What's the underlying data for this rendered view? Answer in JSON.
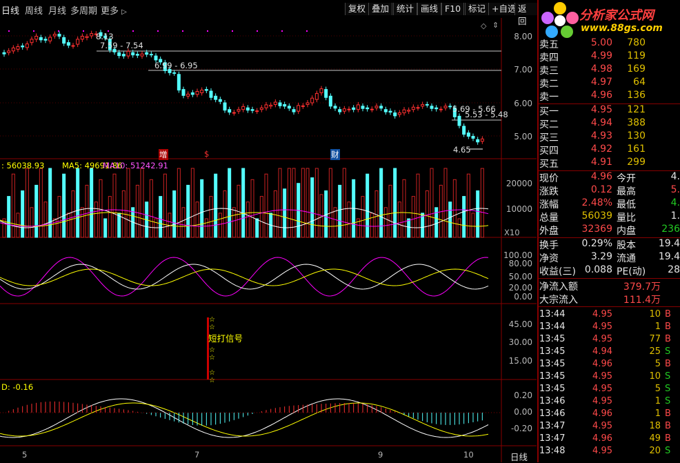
{
  "tabs": [
    {
      "label": "日线"
    },
    {
      "label": "周线"
    },
    {
      "label": "月线"
    },
    {
      "label": "多周期"
    },
    {
      "label": "更多"
    }
  ],
  "toolbar": [
    "复权",
    "叠加",
    "统计",
    "画线",
    "F10",
    "标记",
    "+自选",
    "返回"
  ],
  "logo": {
    "text": "分析家公式网",
    "url": "www.88gs.com"
  },
  "price_axis": [
    "8.00",
    "7.00",
    "6.00",
    "5.00"
  ],
  "annotations": {
    "high": "8.13",
    "r1": "7.59 - 7.54",
    "r2": "6.99 - 6.95",
    "r3": "5.69 - 5.66",
    "r4": "5.53 - 5.48",
    "low": "4.65",
    "badges": [
      "增",
      "$",
      "财"
    ]
  },
  "volume": {
    "vol_label": "56038.93",
    "ma5_label": "MA5: 49691.86",
    "ma10_label": "MA10: 51242.91",
    "axis": [
      "20000",
      "10000"
    ],
    "unit": "X10"
  },
  "kdj_axis": [
    "100.00",
    "80.00",
    "50.00",
    "20.00",
    "0.00"
  ],
  "signal": {
    "label": "短打信号",
    "axis": [
      "45.00",
      "30.00",
      "15.00"
    ]
  },
  "macd": {
    "label": "D: -0.16",
    "axis": [
      "0.20",
      "0.00",
      "-0.20"
    ]
  },
  "xaxis": {
    "labels": [
      "5",
      "7",
      "9",
      "10"
    ],
    "period": "日线"
  },
  "colors": {
    "up": "#ff3030",
    "down": "#54ffff",
    "ma5": "#ffffff",
    "ma10": "#ffff00",
    "ma20": "#ff00ff"
  },
  "quote": {
    "asks": [
      {
        "name": "卖五",
        "price": "5.00",
        "vol": "780"
      },
      {
        "name": "卖四",
        "price": "4.99",
        "vol": "119"
      },
      {
        "name": "卖三",
        "price": "4.98",
        "vol": "169"
      },
      {
        "name": "卖二",
        "price": "4.97",
        "vol": "64"
      },
      {
        "name": "卖一",
        "price": "4.96",
        "vol": "136"
      }
    ],
    "bids": [
      {
        "name": "买一",
        "price": "4.95",
        "vol": "121"
      },
      {
        "name": "买二",
        "price": "4.94",
        "vol": "388"
      },
      {
        "name": "买三",
        "price": "4.93",
        "vol": "130"
      },
      {
        "name": "买四",
        "price": "4.92",
        "vol": "161"
      },
      {
        "name": "买五",
        "price": "4.91",
        "vol": "299"
      }
    ],
    "stats": [
      {
        "l1": "现价",
        "v1": "4.96",
        "c1": "red",
        "l2": "今开",
        "v2": "4.",
        "c2": "white"
      },
      {
        "l1": "涨跌",
        "v1": "0.12",
        "c1": "red",
        "l2": "最高",
        "v2": "5.",
        "c2": "red"
      },
      {
        "l1": "涨幅",
        "v1": "2.48%",
        "c1": "red",
        "l2": "最低",
        "v2": "4.",
        "c2": "green"
      },
      {
        "l1": "总量",
        "v1": "56039",
        "c1": "yellow",
        "l2": "量比",
        "v2": "1.",
        "c2": "white"
      },
      {
        "l1": "外盘",
        "v1": "32369",
        "c1": "red",
        "l2": "内盘",
        "v2": "236",
        "c2": "green"
      }
    ],
    "stats2": [
      {
        "l1": "换手",
        "v1": "0.29%",
        "c1": "white",
        "l2": "股本",
        "v2": "19.4",
        "c2": "white"
      },
      {
        "l1": "净资",
        "v1": "3.29",
        "c1": "white",
        "l2": "流通",
        "v2": "19.4",
        "c2": "white"
      },
      {
        "l1": "收益(三)",
        "v1": "0.088",
        "c1": "white",
        "l2": "PE(动)",
        "v2": "28",
        "c2": "white"
      }
    ],
    "flow": [
      {
        "label": "净流入额",
        "value": "379.7万"
      },
      {
        "label": "大宗流入",
        "value": "111.4万"
      }
    ]
  },
  "ticks": [
    {
      "time": "13:44",
      "price": "4.95",
      "vol": "10",
      "bs": "B"
    },
    {
      "time": "13:44",
      "price": "4.95",
      "vol": "1",
      "bs": "B"
    },
    {
      "time": "13:45",
      "price": "4.95",
      "vol": "77",
      "bs": "B"
    },
    {
      "time": "13:45",
      "price": "4.94",
      "vol": "25",
      "bs": "S"
    },
    {
      "time": "13:45",
      "price": "4.96",
      "vol": "5",
      "bs": "B"
    },
    {
      "time": "13:45",
      "price": "4.95",
      "vol": "10",
      "bs": "S"
    },
    {
      "time": "13:45",
      "price": "4.95",
      "vol": "5",
      "bs": "S"
    },
    {
      "time": "13:46",
      "price": "4.95",
      "vol": "1",
      "bs": "S"
    },
    {
      "time": "13:46",
      "price": "4.96",
      "vol": "1",
      "bs": "B"
    },
    {
      "time": "13:47",
      "price": "4.95",
      "vol": "18",
      "bs": "B"
    },
    {
      "time": "13:47",
      "price": "4.96",
      "vol": "49",
      "bs": "B"
    },
    {
      "time": "13:48",
      "price": "4.95",
      "vol": "20",
      "bs": "S"
    }
  ]
}
